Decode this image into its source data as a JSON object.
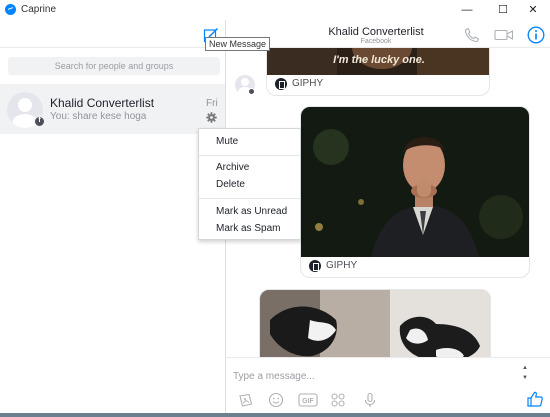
{
  "window": {
    "title": "Caprine",
    "minimize_glyph": "—",
    "maximize_glyph": "☐",
    "close_glyph": "✕"
  },
  "sidebar": {
    "search_placeholder": "Search for people and groups",
    "new_message_tooltip": "New Message",
    "conversations": [
      {
        "name": "Khalid Converterlist",
        "snippet": "You: share kese hoga",
        "time": "Fri"
      }
    ]
  },
  "context_menu": {
    "items": [
      "Mute",
      "Archive",
      "Delete",
      "Mark as Unread",
      "Mark as Spam"
    ]
  },
  "chat": {
    "title": "Khalid Converterlist",
    "subtitle": "Facebook",
    "messages": [
      {
        "type": "gif",
        "caption_text": "I'm the lucky one.",
        "source": "GIPHY"
      },
      {
        "type": "gif",
        "source": "GIPHY"
      },
      {
        "type": "gif"
      }
    ]
  },
  "composer": {
    "placeholder": "Type a message...",
    "gif_label": "GIF"
  },
  "colors": {
    "accent": "#0084ff",
    "selected_row": "#f1f2f4"
  },
  "icons": [
    "compose-icon",
    "gear-icon",
    "phone-icon",
    "video-icon",
    "info-icon",
    "sticker-icon",
    "emoji-icon",
    "gif-icon",
    "apps-icon",
    "microphone-icon",
    "thumbs-up-icon"
  ]
}
